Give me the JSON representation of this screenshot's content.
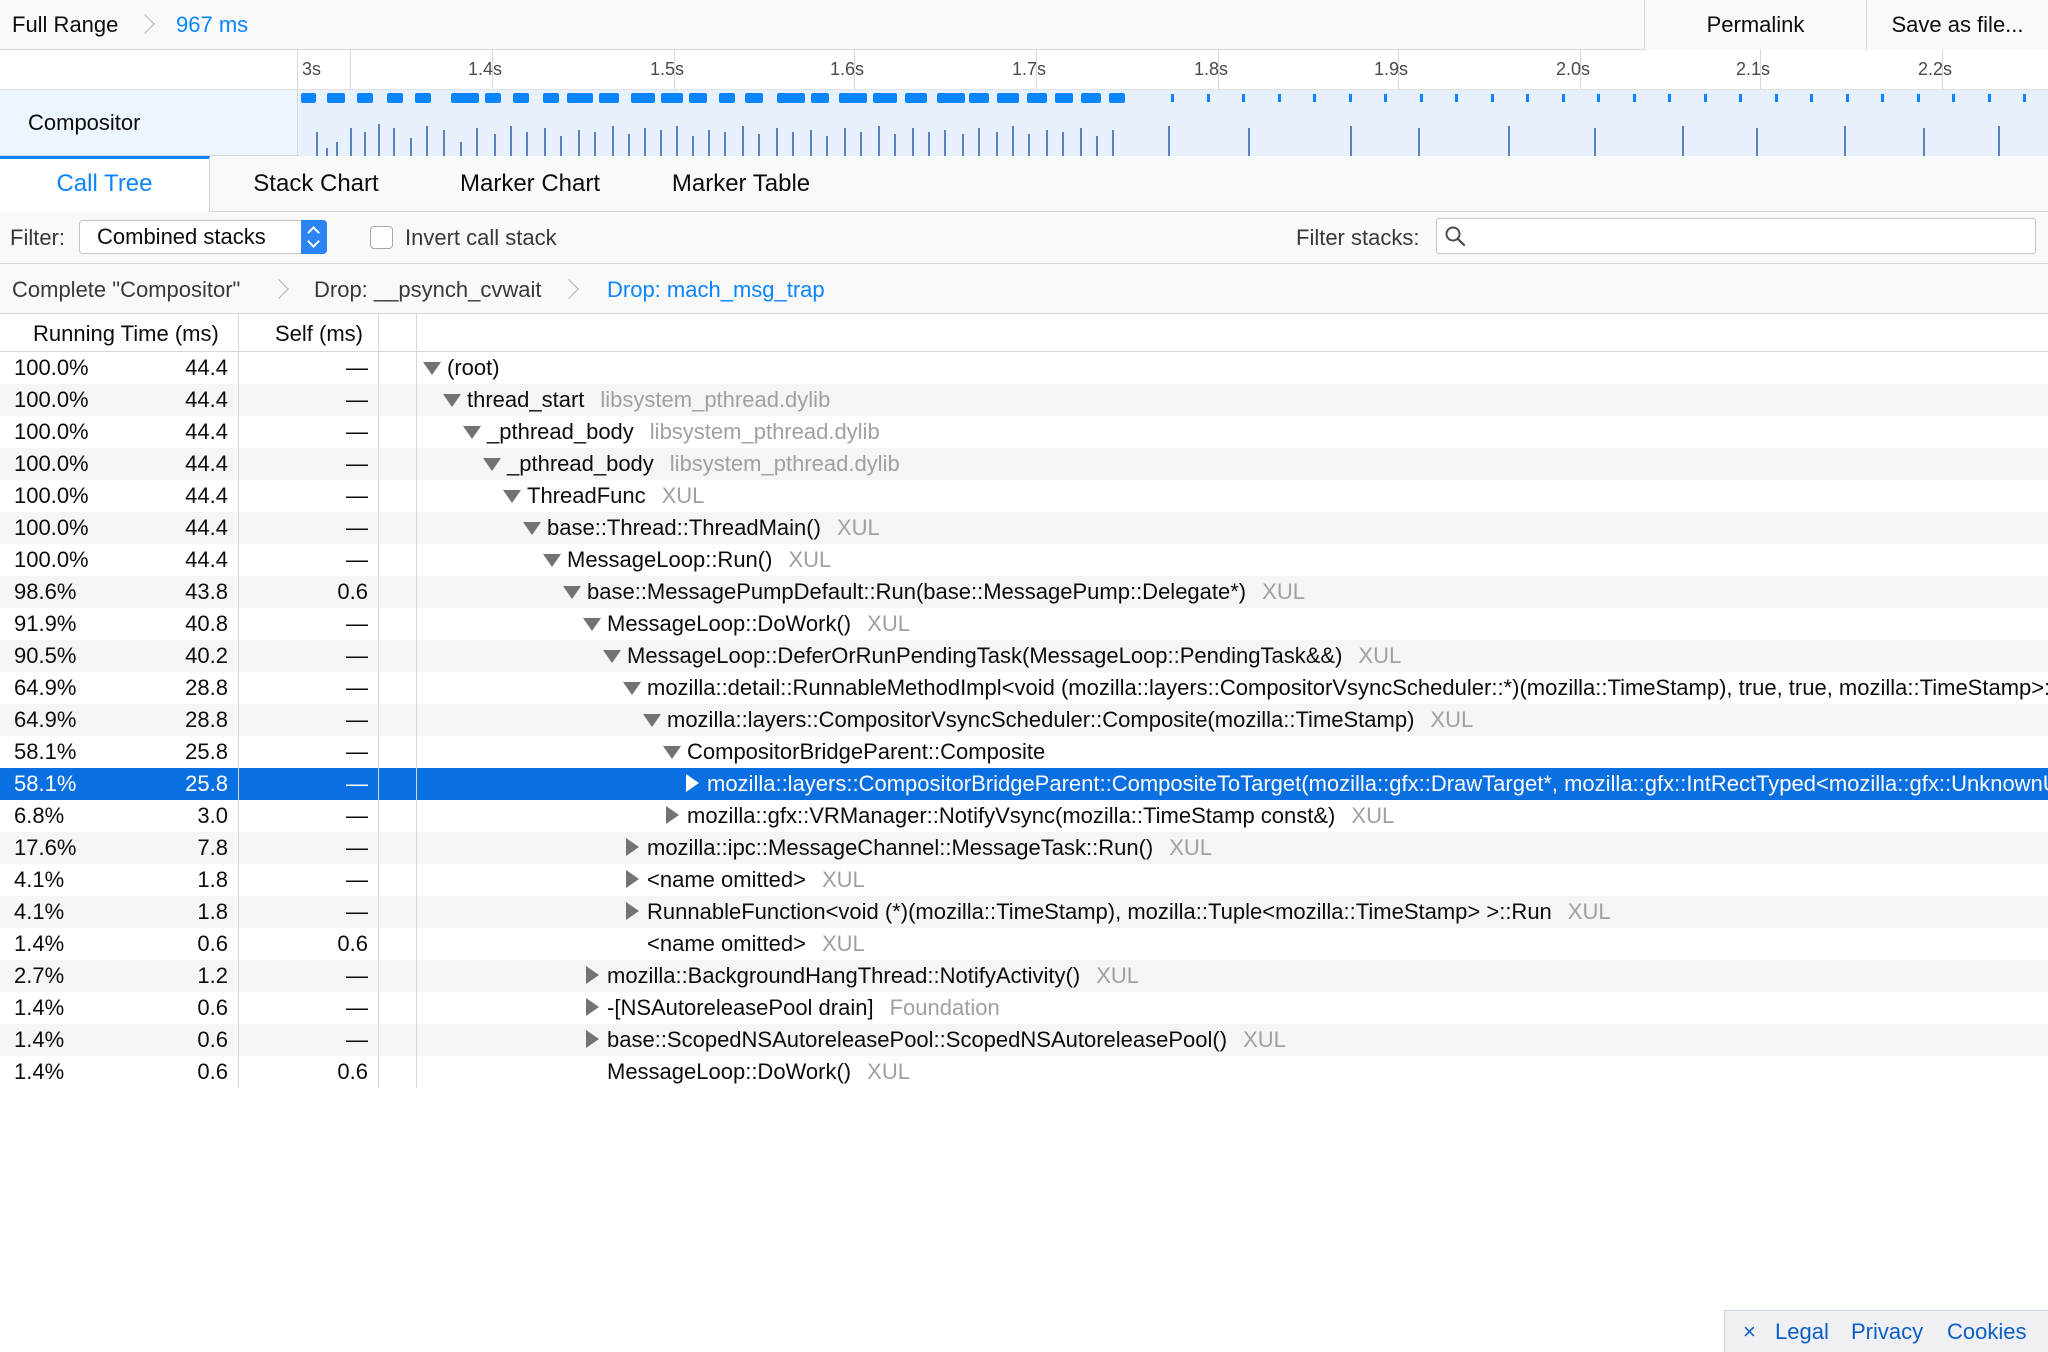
{
  "topbar": {
    "full_range": "Full Range",
    "range_duration": "967 ms",
    "permalink": "Permalink",
    "save_as_file": "Save as file..."
  },
  "timeline": {
    "tick_labels": [
      "3s",
      "1.4s",
      "1.5s",
      "1.6s",
      "1.7s",
      "1.8s",
      "1.9s",
      "2.0s",
      "2.1s",
      "2.2s"
    ],
    "track_name": "Compositor",
    "accent_color": "#0a84ff"
  },
  "tabs": [
    {
      "label": "Call Tree",
      "active": true
    },
    {
      "label": "Stack Chart",
      "active": false
    },
    {
      "label": "Marker Chart",
      "active": false
    },
    {
      "label": "Marker Table",
      "active": false
    }
  ],
  "filter": {
    "label": "Filter:",
    "selected": "Combined stacks",
    "invert_label": "Invert call stack",
    "invert_checked": false,
    "filter_stacks_label": "Filter stacks:",
    "search_value": "",
    "search_icon": "search-icon"
  },
  "transform_breadcrumbs": [
    "Complete \"Compositor\"",
    "Drop: __psynch_cvwait",
    "Drop: mach_msg_trap"
  ],
  "columns": {
    "running_time": "Running Time (ms)",
    "self": "Self (ms)"
  },
  "rows": [
    {
      "total": "100.0%",
      "ms": "44.4",
      "self": "—",
      "depth": 0,
      "twisty": "open",
      "func": "(root)",
      "lib": ""
    },
    {
      "total": "100.0%",
      "ms": "44.4",
      "self": "—",
      "depth": 1,
      "twisty": "open",
      "func": "thread_start",
      "lib": "libsystem_pthread.dylib"
    },
    {
      "total": "100.0%",
      "ms": "44.4",
      "self": "—",
      "depth": 2,
      "twisty": "open",
      "func": "_pthread_body",
      "lib": "libsystem_pthread.dylib"
    },
    {
      "total": "100.0%",
      "ms": "44.4",
      "self": "—",
      "depth": 3,
      "twisty": "open",
      "func": "_pthread_body",
      "lib": "libsystem_pthread.dylib"
    },
    {
      "total": "100.0%",
      "ms": "44.4",
      "self": "—",
      "depth": 4,
      "twisty": "open",
      "func": "ThreadFunc",
      "lib": "XUL"
    },
    {
      "total": "100.0%",
      "ms": "44.4",
      "self": "—",
      "depth": 5,
      "twisty": "open",
      "func": "base::Thread::ThreadMain()",
      "lib": "XUL"
    },
    {
      "total": "100.0%",
      "ms": "44.4",
      "self": "—",
      "depth": 6,
      "twisty": "open",
      "func": "MessageLoop::Run()",
      "lib": "XUL"
    },
    {
      "total": "98.6%",
      "ms": "43.8",
      "self": "0.6",
      "depth": 7,
      "twisty": "open",
      "func": "base::MessagePumpDefault::Run(base::MessagePump::Delegate*)",
      "lib": "XUL"
    },
    {
      "total": "91.9%",
      "ms": "40.8",
      "self": "—",
      "depth": 8,
      "twisty": "open",
      "func": "MessageLoop::DoWork()",
      "lib": "XUL"
    },
    {
      "total": "90.5%",
      "ms": "40.2",
      "self": "—",
      "depth": 9,
      "twisty": "open",
      "func": "MessageLoop::DeferOrRunPendingTask(MessageLoop::PendingTask&&)",
      "lib": "XUL"
    },
    {
      "total": "64.9%",
      "ms": "28.8",
      "self": "—",
      "depth": 10,
      "twisty": "open",
      "func": "mozilla::detail::RunnableMethodImpl<void (mozilla::layers::CompositorVsyncScheduler::*)(mozilla::TimeStamp), true, true, mozilla::TimeStamp>::Run()",
      "lib": "XUL"
    },
    {
      "total": "64.9%",
      "ms": "28.8",
      "self": "—",
      "depth": 11,
      "twisty": "open",
      "func": "mozilla::layers::CompositorVsyncScheduler::Composite(mozilla::TimeStamp)",
      "lib": "XUL"
    },
    {
      "total": "58.1%",
      "ms": "25.8",
      "self": "—",
      "depth": 12,
      "twisty": "open",
      "func": "CompositorBridgeParent::Composite",
      "lib": ""
    },
    {
      "total": "58.1%",
      "ms": "25.8",
      "self": "—",
      "depth": 13,
      "twisty": "closed",
      "func": "mozilla::layers::CompositorBridgeParent::CompositeToTarget(mozilla::gfx::DrawTarget*, mozilla::gfx::IntRectTyped<mozilla::gfx::UnknownUnits> const*)",
      "lib": "XUL",
      "selected": true
    },
    {
      "total": "6.8%",
      "ms": "3.0",
      "self": "—",
      "depth": 12,
      "twisty": "closed",
      "func": "mozilla::gfx::VRManager::NotifyVsync(mozilla::TimeStamp const&)",
      "lib": "XUL"
    },
    {
      "total": "17.6%",
      "ms": "7.8",
      "self": "—",
      "depth": 10,
      "twisty": "closed",
      "func": "mozilla::ipc::MessageChannel::MessageTask::Run()",
      "lib": "XUL"
    },
    {
      "total": "4.1%",
      "ms": "1.8",
      "self": "—",
      "depth": 10,
      "twisty": "closed",
      "func": "<name omitted>",
      "lib": "XUL"
    },
    {
      "total": "4.1%",
      "ms": "1.8",
      "self": "—",
      "depth": 10,
      "twisty": "closed",
      "func": "RunnableFunction<void (*)(mozilla::TimeStamp), mozilla::Tuple<mozilla::TimeStamp> >::Run",
      "lib": "XUL"
    },
    {
      "total": "1.4%",
      "ms": "0.6",
      "self": "0.6",
      "depth": 10,
      "twisty": "none",
      "func": "<name omitted>",
      "lib": "XUL"
    },
    {
      "total": "2.7%",
      "ms": "1.2",
      "self": "—",
      "depth": 8,
      "twisty": "closed",
      "func": "mozilla::BackgroundHangThread::NotifyActivity()",
      "lib": "XUL"
    },
    {
      "total": "1.4%",
      "ms": "0.6",
      "self": "—",
      "depth": 8,
      "twisty": "closed",
      "func": "-[NSAutoreleasePool drain]",
      "lib": "Foundation"
    },
    {
      "total": "1.4%",
      "ms": "0.6",
      "self": "—",
      "depth": 8,
      "twisty": "closed",
      "func": "base::ScopedNSAutoreleasePool::ScopedNSAutoreleasePool()",
      "lib": "XUL"
    },
    {
      "total": "1.4%",
      "ms": "0.6",
      "self": "0.6",
      "depth": 8,
      "twisty": "none",
      "func": "MessageLoop::DoWork()",
      "lib": "XUL"
    }
  ],
  "footer": {
    "close": "×",
    "legal": "Legal",
    "privacy": "Privacy",
    "cookies": "Cookies"
  }
}
